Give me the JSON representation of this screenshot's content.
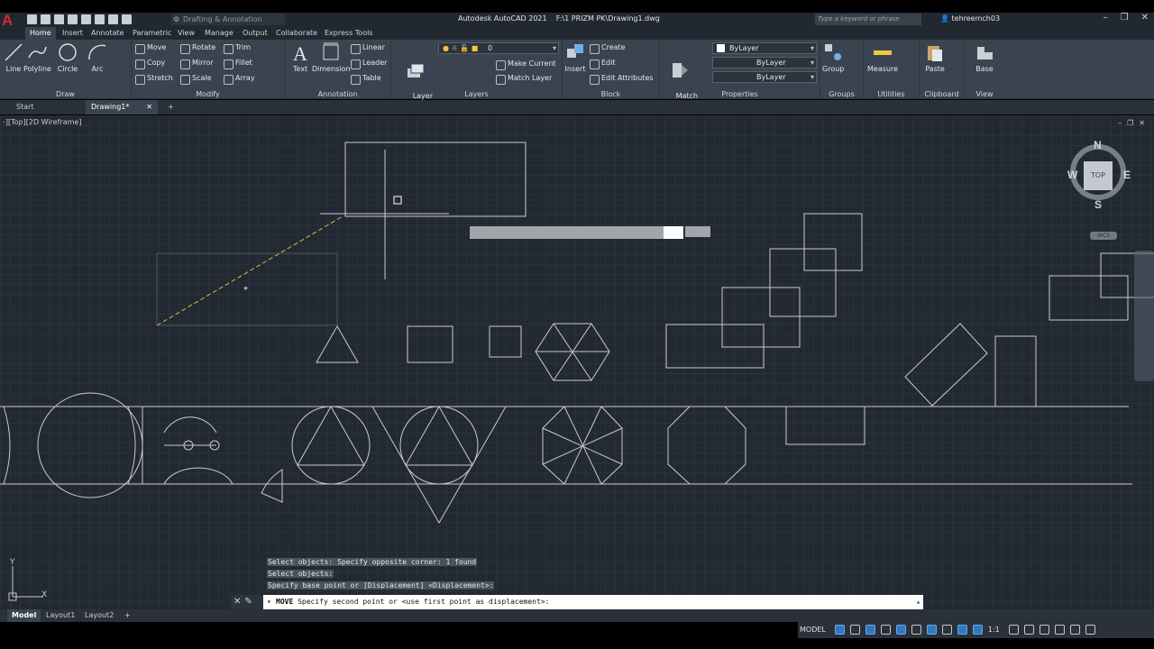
{
  "app": {
    "title": "Autodesk AutoCAD 2021    F:\\1 PRIZM PK\\Drawing1.dwg",
    "workspace": "Drafting & Annotation",
    "search_placeholder": "Type a keyword or phrase",
    "user": "tehreemch03"
  },
  "ribbon_tabs": [
    "Home",
    "Insert",
    "Annotate",
    "Parametric",
    "View",
    "Manage",
    "Output",
    "Collaborate",
    "Express Tools"
  ],
  "ribbon": {
    "draw": {
      "title": "Draw",
      "line": "Line",
      "polyline": "Polyline",
      "circle": "Circle",
      "arc": "Arc"
    },
    "modify": {
      "title": "Modify",
      "move": "Move",
      "rotate": "Rotate",
      "trim": "Trim",
      "copy": "Copy",
      "mirror": "Mirror",
      "fillet": "Fillet",
      "stretch": "Stretch",
      "scale": "Scale",
      "array": "Array"
    },
    "annotation": {
      "title": "Annotation",
      "text": "Text",
      "dimension": "Dimension",
      "linear": "Linear",
      "leader": "Leader",
      "table": "Table"
    },
    "layers": {
      "title": "Layers",
      "layer_properties": "Layer\nProperties",
      "layer_value": "0",
      "make_current": "Make Current",
      "match_layer": "Match Layer"
    },
    "block": {
      "title": "Block",
      "insert": "Insert",
      "create": "Create",
      "edit": "Edit",
      "edit_attributes": "Edit Attributes"
    },
    "properties": {
      "title": "Properties",
      "match_properties": "Match\nProperties",
      "color": "ByLayer",
      "linetype": "ByLayer",
      "lineweight": "ByLayer"
    },
    "groups": {
      "title": "Groups",
      "group": "Group"
    },
    "utilities": {
      "title": "Utilities",
      "measure": "Measure"
    },
    "clipboard": {
      "title": "Clipboard",
      "paste": "Paste"
    },
    "view": {
      "title": "View",
      "base": "Base"
    }
  },
  "doc_tabs": [
    "Start",
    "Drawing1*"
  ],
  "viewport": {
    "label": "-][Top][2D Wireframe]"
  },
  "viewcube": {
    "face": "TOP",
    "n": "N",
    "s": "S",
    "e": "E",
    "w": "W",
    "wcs": "WCS"
  },
  "ucs": {
    "x": "X",
    "y": "Y"
  },
  "command": {
    "history": [
      "Select objects: Specify opposite corner: 1 found",
      "Select objects:",
      "Specify base point or [Displacement] <Displacement>:"
    ],
    "active_name": "MOVE",
    "active_prompt": "Specify second point or <use first point as displacement>:"
  },
  "layout_tabs": [
    "Model",
    "Layout1",
    "Layout2"
  ],
  "status": {
    "model": "MODEL",
    "scale": "1:1"
  },
  "colors": {
    "canvas": "#222933",
    "ribbon": "#3a4450",
    "accent": "#2f79c4"
  }
}
